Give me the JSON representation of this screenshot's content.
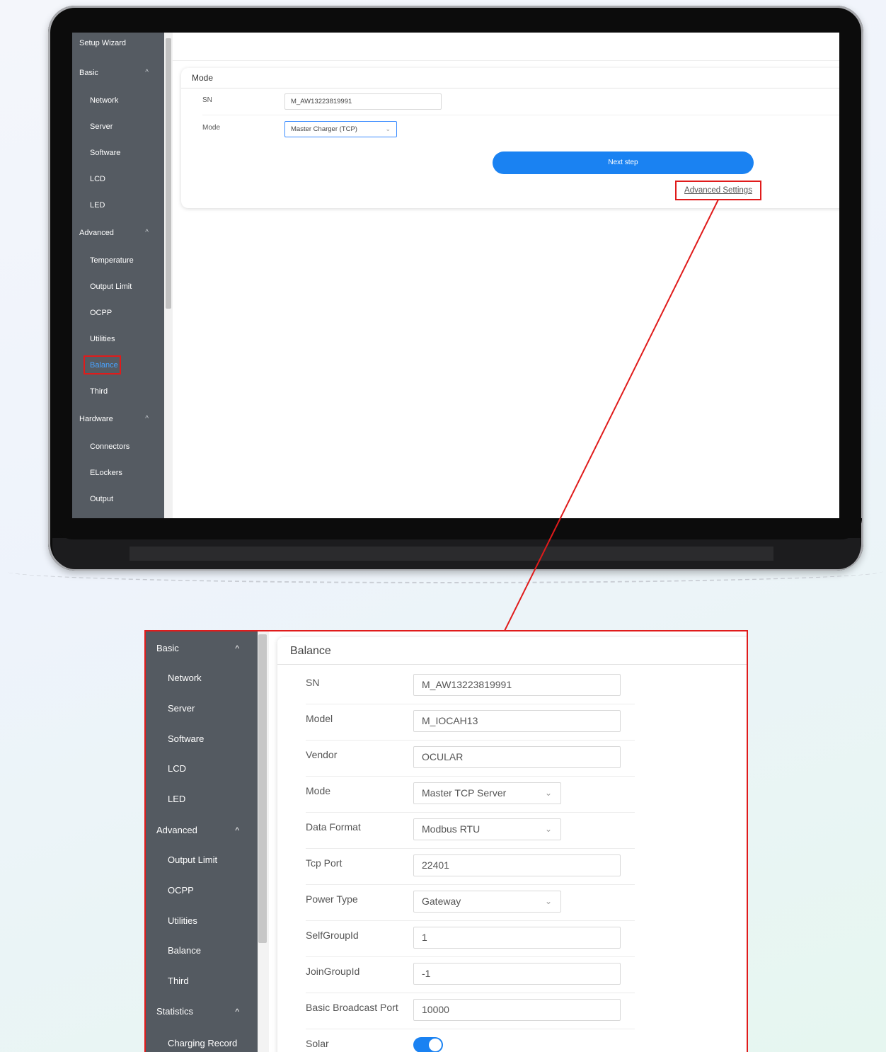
{
  "colors": {
    "accent": "#1a82f2",
    "callout": "#e01b1b",
    "sidebar_bg": "#555b62"
  },
  "laptop": {
    "sidebar": {
      "setup_wizard": "Setup Wizard",
      "basic": "Basic",
      "network": "Network",
      "server": "Server",
      "software": "Software",
      "lcd": "LCD",
      "led": "LED",
      "advanced": "Advanced",
      "temperature": "Temperature",
      "output_limit": "Output Limit",
      "ocpp": "OCPP",
      "utilities": "Utilities",
      "balance": "Balance",
      "third": "Third",
      "hardware": "Hardware",
      "connectors": "Connectors",
      "elockers": "ELockers",
      "output": "Output",
      "chevron": "^"
    },
    "mode_card": {
      "title": "Mode",
      "sn_label": "SN",
      "sn_value": "M_AW13223819991",
      "mode_label": "Mode",
      "mode_value": "Master Charger (TCP)",
      "next_button": "Next step",
      "advanced_link": "Advanced Settings"
    }
  },
  "zoom": {
    "sidebar": {
      "basic": "Basic",
      "network": "Network",
      "server": "Server",
      "software": "Software",
      "lcd": "LCD",
      "led": "LED",
      "advanced": "Advanced",
      "output_limit": "Output Limit",
      "ocpp": "OCPP",
      "utilities": "Utilities",
      "balance": "Balance",
      "third": "Third",
      "statistics": "Statistics",
      "charging_record": "Charging Record",
      "chevron": "^"
    },
    "card": {
      "title": "Balance",
      "rows": [
        {
          "label": "SN",
          "value": "M_AW13223819991"
        },
        {
          "label": "Model",
          "value": "M_IOCAH13"
        },
        {
          "label": "Vendor",
          "value": "OCULAR"
        },
        {
          "label": "Mode",
          "value": "Master TCP Server"
        },
        {
          "label": "Data Format",
          "value": "Modbus RTU"
        },
        {
          "label": "Tcp Port",
          "value": "22401"
        },
        {
          "label": "Power Type",
          "value": "Gateway"
        },
        {
          "label": "SelfGroupId",
          "value": "1"
        },
        {
          "label": "JoinGroupId",
          "value": "-1"
        },
        {
          "label": "Basic Broadcast Port",
          "value": "10000"
        },
        {
          "label": "Solar",
          "value": ""
        }
      ],
      "solar_enabled": true
    }
  }
}
